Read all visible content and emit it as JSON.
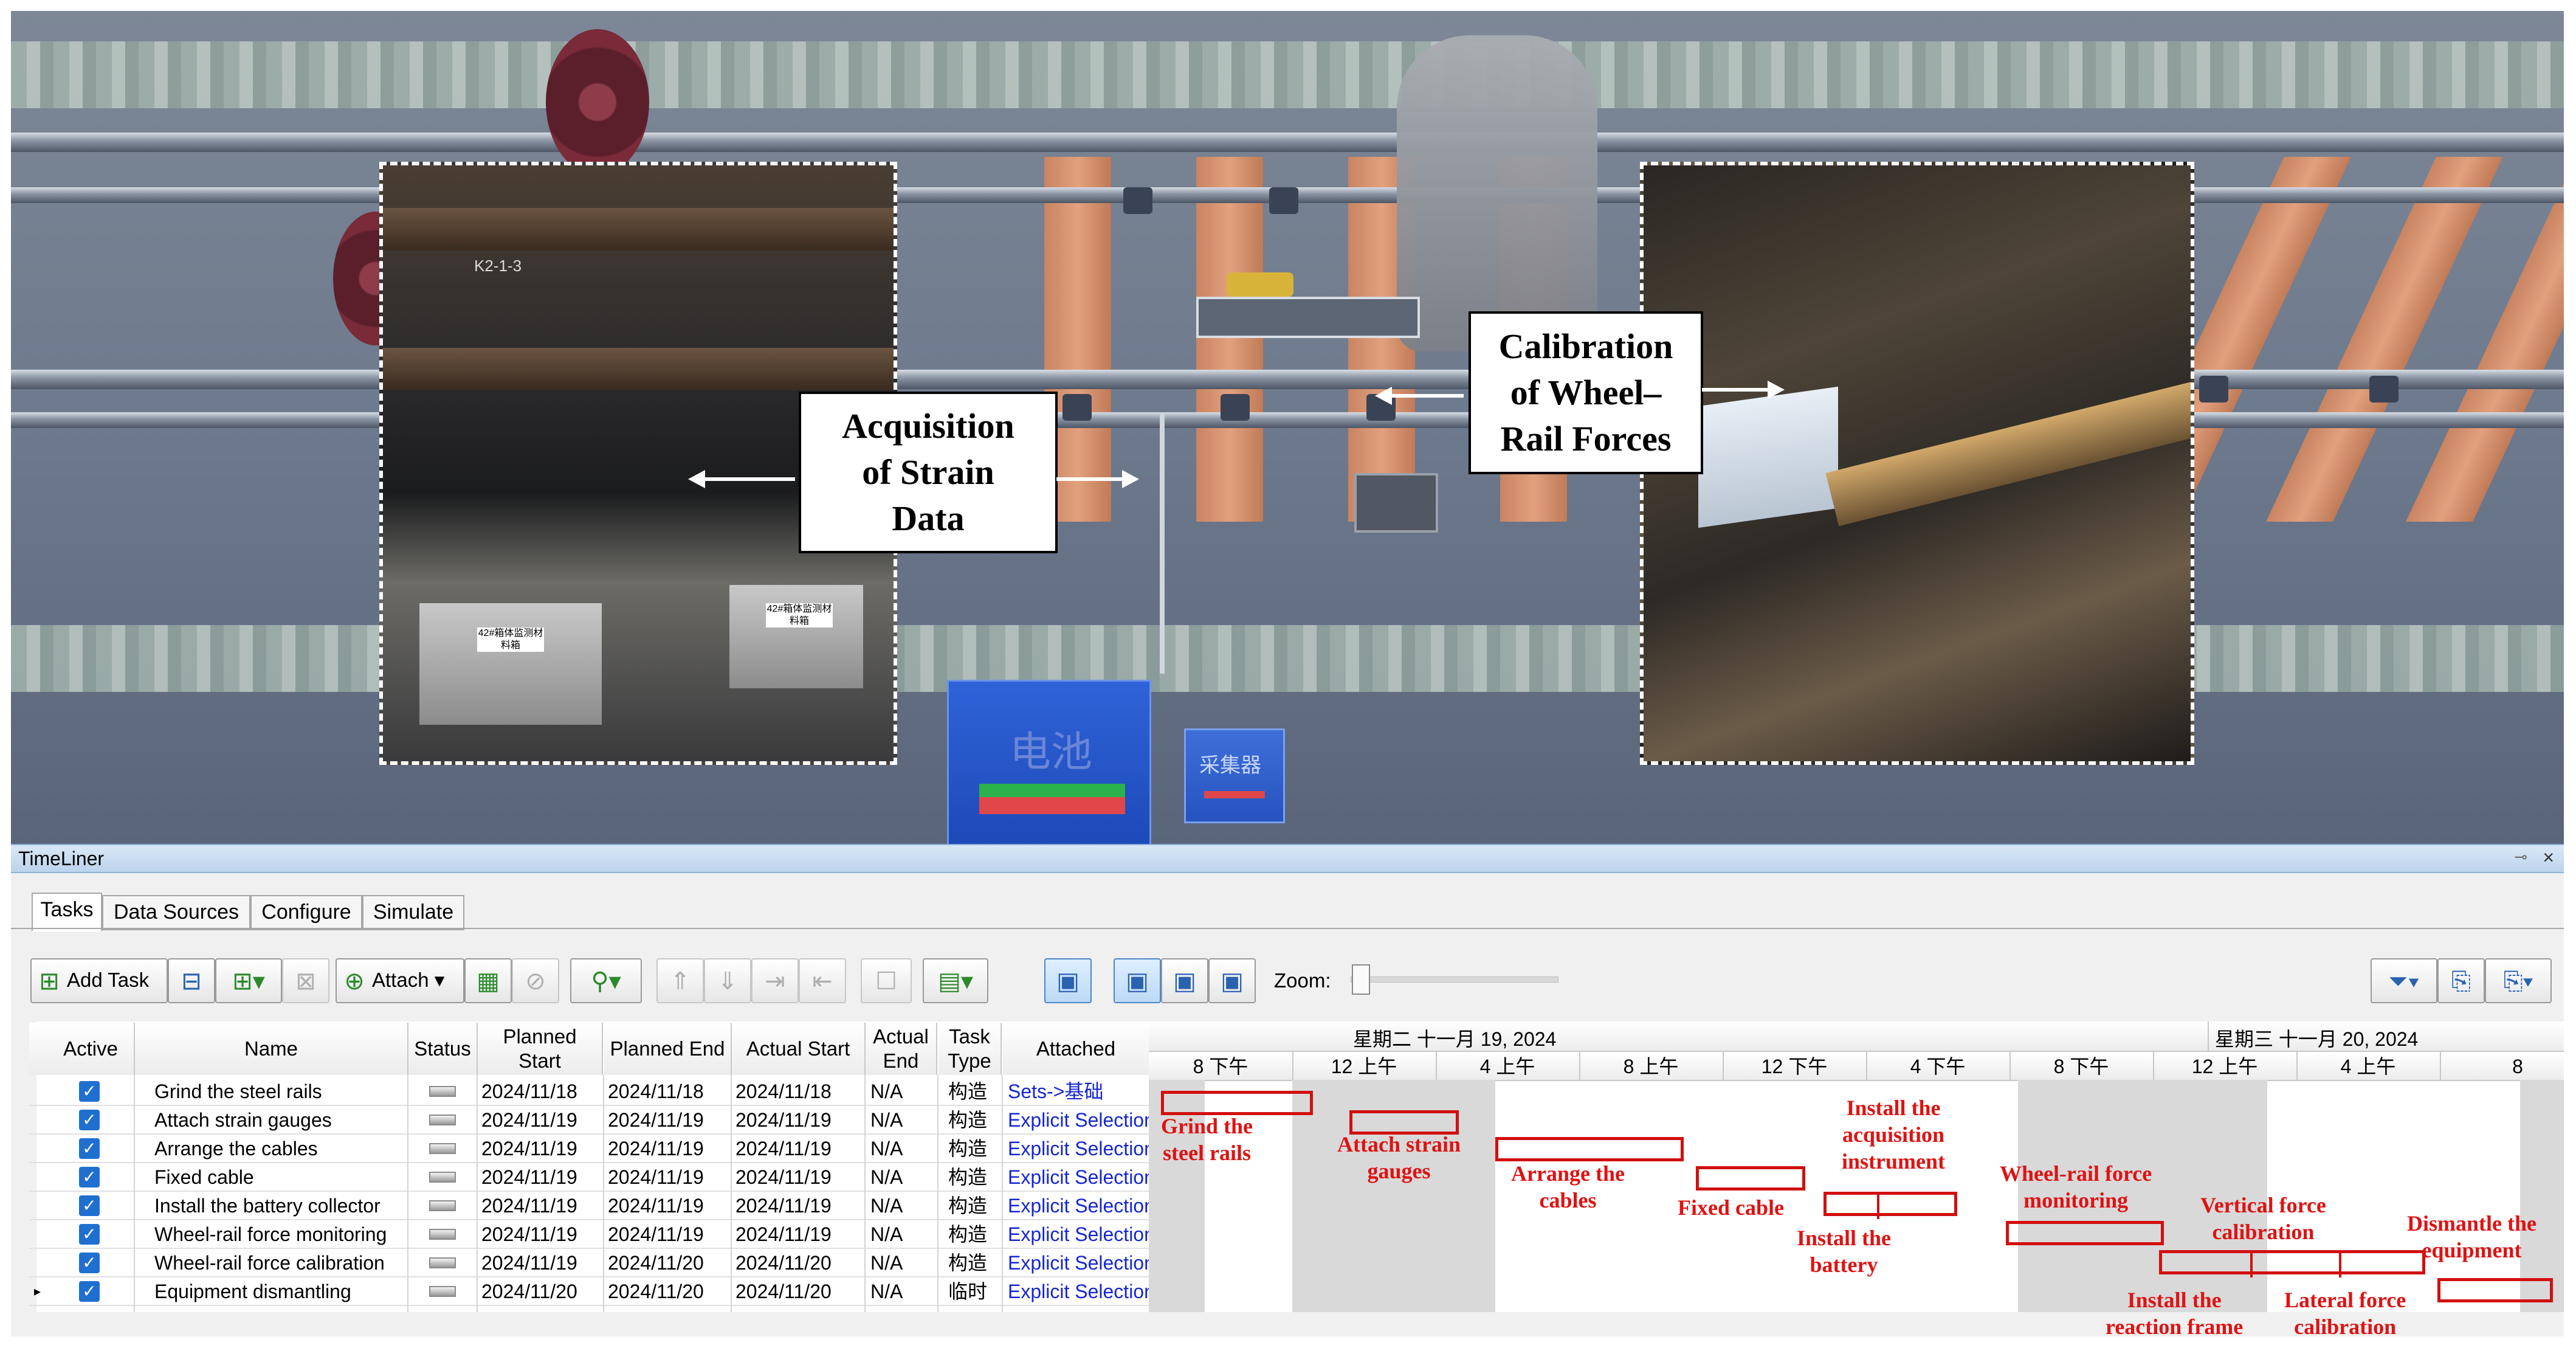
{
  "scene": {
    "battery_label": "电池",
    "collector_label": "采集器",
    "box_labels": [
      "42#箱体监测材料箱",
      "42#箱体监测材料箱"
    ],
    "rail_mark": "K2-1-3",
    "callouts": {
      "strain": [
        "Acquisition",
        "of Strain",
        "Data"
      ],
      "calibration": [
        "Calibration",
        "of Wheel–",
        "Rail Forces"
      ]
    }
  },
  "panel": {
    "title": "TimeLiner",
    "tabs": [
      "Tasks",
      "Data Sources",
      "Configure",
      "Simulate"
    ],
    "toolbar": {
      "add_task": "Add Task",
      "attach": "Attach",
      "zoom_label": "Zoom:",
      "zoom_level": 0
    },
    "columns": [
      "Active",
      "Name",
      "Status",
      "Planned Start",
      "Planned End",
      "Actual Start",
      "Actual End",
      "Task Type",
      "Attached"
    ],
    "rows": [
      {
        "name": "Grind the steel rails",
        "planned_start": "2024/11/18",
        "planned_end": "2024/11/18",
        "actual_start": "2024/11/18",
        "actual_end": "N/A",
        "task_type": "构造",
        "attached": "Sets->基础"
      },
      {
        "name": "Attach strain gauges",
        "planned_start": "2024/11/19",
        "planned_end": "2024/11/19",
        "actual_start": "2024/11/19",
        "actual_end": "N/A",
        "task_type": "构造",
        "attached": "Explicit Selection"
      },
      {
        "name": "Arrange the cables",
        "planned_start": "2024/11/19",
        "planned_end": "2024/11/19",
        "actual_start": "2024/11/19",
        "actual_end": "N/A",
        "task_type": "构造",
        "attached": "Explicit Selection"
      },
      {
        "name": "Fixed cable",
        "planned_start": "2024/11/19",
        "planned_end": "2024/11/19",
        "actual_start": "2024/11/19",
        "actual_end": "N/A",
        "task_type": "构造",
        "attached": "Explicit Selection"
      },
      {
        "name": "Install the battery collector",
        "planned_start": "2024/11/19",
        "planned_end": "2024/11/19",
        "actual_start": "2024/11/19",
        "actual_end": "N/A",
        "task_type": "构造",
        "attached": "Explicit Selection"
      },
      {
        "name": "Wheel-rail force monitoring",
        "planned_start": "2024/11/19",
        "planned_end": "2024/11/19",
        "actual_start": "2024/11/19",
        "actual_end": "N/A",
        "task_type": "构造",
        "attached": "Explicit Selection"
      },
      {
        "name": "Wheel-rail force calibration",
        "planned_start": "2024/11/19",
        "planned_end": "2024/11/20",
        "actual_start": "2024/11/20",
        "actual_end": "N/A",
        "task_type": "构造",
        "attached": "Explicit Selection"
      },
      {
        "name": "Equipment dismantling",
        "planned_start": "2024/11/20",
        "planned_end": "2024/11/20",
        "actual_start": "2024/11/20",
        "actual_end": "N/A",
        "task_type": "临时",
        "attached": "Explicit Selection"
      }
    ],
    "gantt": {
      "dates": [
        "星期二 十一月 19, 2024",
        "星期三 十一月 20, 2024"
      ],
      "hours": [
        "8 下午",
        "12 上午",
        "4 上午",
        "8 上午",
        "12 下午",
        "4 下午",
        "8 下午",
        "12 上午",
        "4 上午",
        "8"
      ],
      "annotations": {
        "grind": [
          "Grind the",
          "steel rails"
        ],
        "strain": [
          "Attach strain",
          "gauges"
        ],
        "arrange": [
          "Arrange the",
          "cables"
        ],
        "fixed": [
          "Fixed cable"
        ],
        "acq": [
          "Install the",
          "acquisition",
          "instrument"
        ],
        "battery": [
          "Install the",
          "battery"
        ],
        "monitor": [
          "Wheel-rail force",
          "monitoring"
        ],
        "vertical": [
          "Vertical force",
          "calibration"
        ],
        "dismantle": [
          "Dismantle the",
          "equipment"
        ],
        "reaction": [
          "Install the",
          "reaction frame"
        ],
        "lateral": [
          "Lateral force",
          "calibration"
        ]
      }
    }
  },
  "colors": {
    "accent": "#d20f0f",
    "link": "#1526d6",
    "check": "#1f6fd0"
  }
}
